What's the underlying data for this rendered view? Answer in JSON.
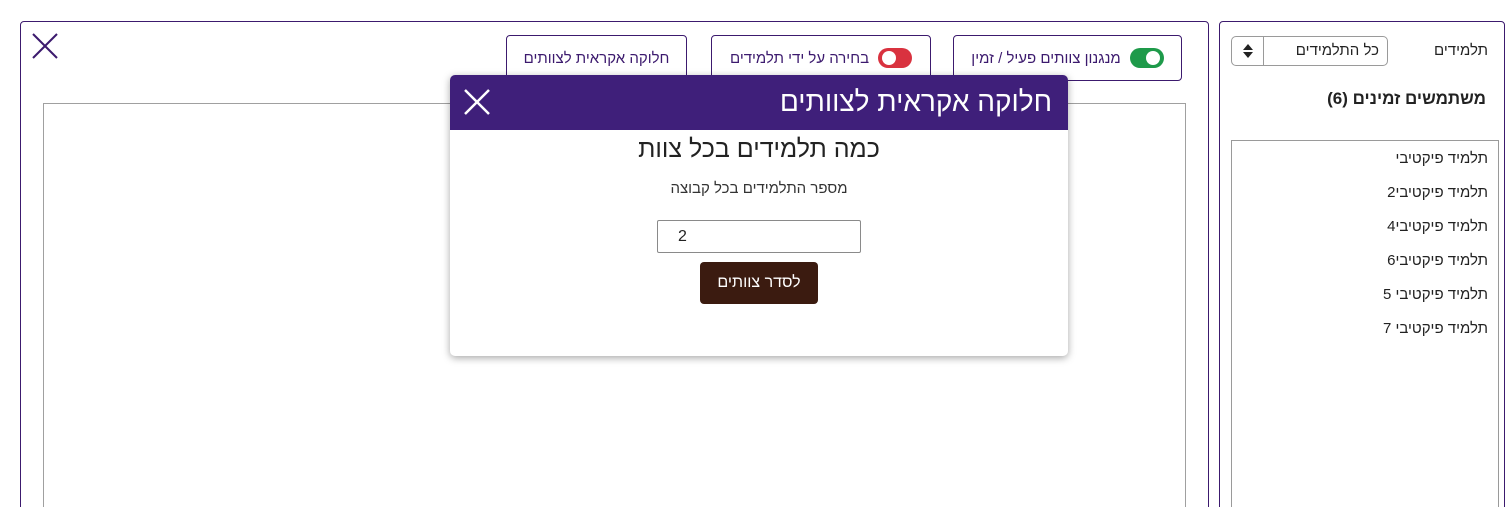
{
  "sidebar": {
    "students_label": "תלמידים",
    "filter_select": {
      "value": "כל התלמידים"
    },
    "users_heading": "משתמשים זמינים (6)",
    "users": [
      "תלמיד פיקטיבי",
      "תלמיד פיקטיבי2",
      "תלמיד פיקטיבי4",
      "תלמיד פיקטיבי6",
      "תלמיד פיקטיבי 5",
      "תלמיד פיקטיבי 7"
    ]
  },
  "toolbar": {
    "active_mechanism": {
      "label": "מנגנון צוותים פעיל / זמין",
      "toggle_on": true
    },
    "student_choice": {
      "label": "בחירה על ידי תלמידים",
      "toggle_on": false
    },
    "random_split": {
      "label": "חלוקה אקראית לצוותים"
    }
  },
  "icons": {
    "main_close": "close-icon",
    "modal_close": "close-icon",
    "select_arrows": "sort-arrows-icon"
  },
  "colors": {
    "brand_purple": "#3f1f7a",
    "toggle_on": "#1e9a4a",
    "toggle_off": "#d9323f",
    "action_button": "#3b1b10"
  },
  "modal": {
    "title": "חלוקה אקראית לצוותים",
    "question": "כמה תלמידים בכל צוות",
    "sublabel": "מספר התלמידים בכל קבוצה",
    "input_value": "2",
    "submit_label": "לסדר צוותים"
  }
}
